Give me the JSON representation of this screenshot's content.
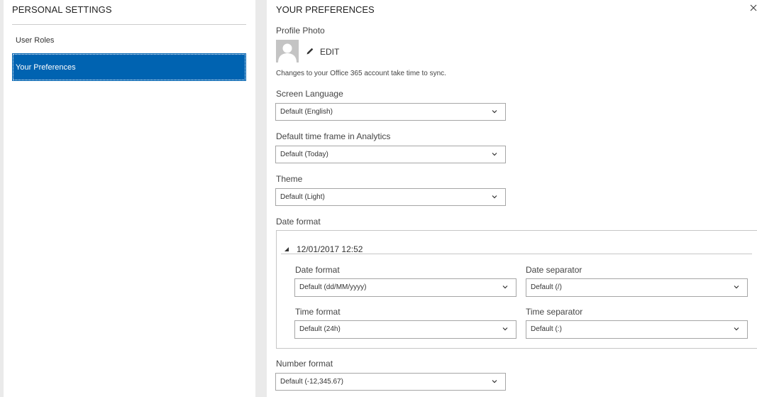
{
  "sidebar": {
    "title": "PERSONAL SETTINGS",
    "items": [
      {
        "label": "User Roles",
        "selected": false
      },
      {
        "label": "Your Preferences",
        "selected": true
      }
    ]
  },
  "main": {
    "title": "YOUR PREFERENCES",
    "profile_photo": {
      "label": "Profile Photo",
      "edit_label": "EDIT",
      "sync_note": "Changes to your Office 365 account take time to sync."
    },
    "screen_language": {
      "label": "Screen Language",
      "value": "Default (English)"
    },
    "time_frame": {
      "label": "Default time frame in Analytics",
      "value": "Default (Today)"
    },
    "theme": {
      "label": "Theme",
      "value": "Default (Light)"
    },
    "date_format_section": {
      "label": "Date format",
      "preview": "12/01/2017 12:52",
      "date_format": {
        "label": "Date format",
        "value": "Default (dd/MM/yyyy)"
      },
      "date_separator": {
        "label": "Date separator",
        "value": "Default (/)"
      },
      "time_format": {
        "label": "Time format",
        "value": "Default (24h)"
      },
      "time_separator": {
        "label": "Time separator",
        "value": "Default (:)"
      }
    },
    "number_format": {
      "label": "Number format",
      "value": "Default (-12,345.67)"
    }
  },
  "icons": [
    "close-icon",
    "avatar-icon",
    "pencil-icon",
    "chevron-down-icon",
    "triangle-collapse-icon"
  ],
  "colors": {
    "accent": "#0063b1",
    "panel_gutter": "#eaeaea",
    "border": "#a6a6a6"
  }
}
